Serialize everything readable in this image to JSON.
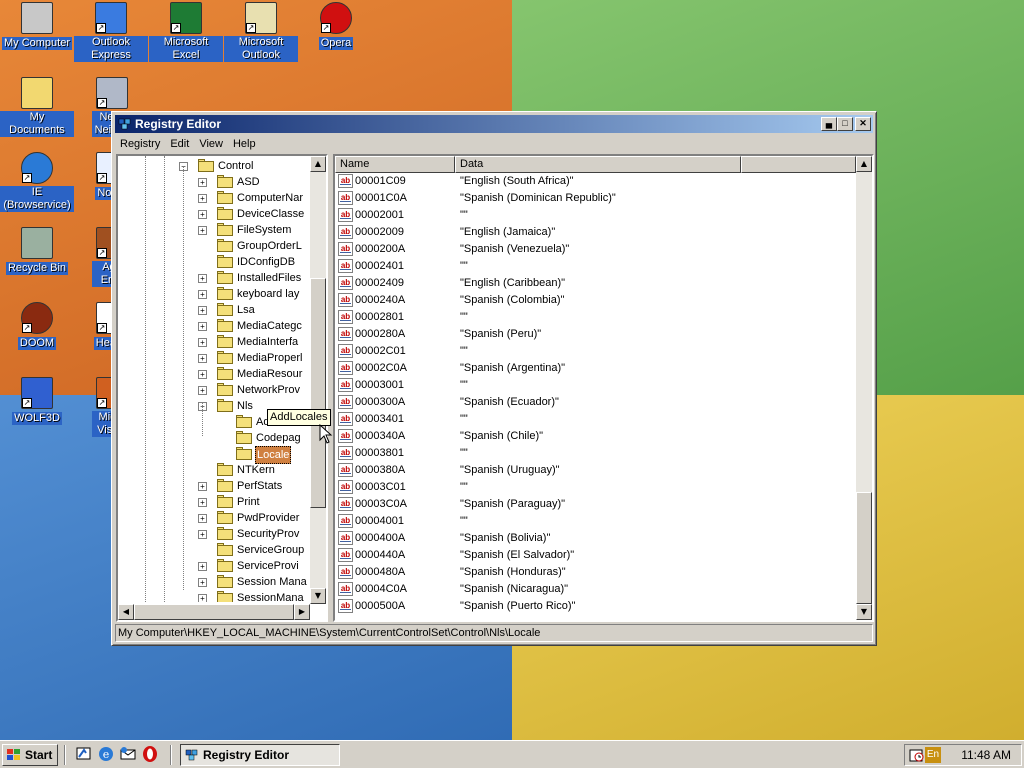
{
  "desktop": {
    "icons": [
      {
        "label": "My Computer",
        "icon": "my-computer-icon"
      },
      {
        "label": "Outlook Express",
        "icon": "outlook-express-icon"
      },
      {
        "label": "Microsoft Excel",
        "icon": "excel-icon"
      },
      {
        "label": "Microsoft Outlook",
        "icon": "outlook-icon"
      },
      {
        "label": "Opera",
        "icon": "opera-icon"
      },
      {
        "label": "My Documents",
        "icon": "my-documents-icon"
      },
      {
        "label": "Netw Neighb",
        "icon": "network-icon"
      },
      {
        "label": "IE (Browservice)",
        "icon": "ie-icon"
      },
      {
        "label": "Notep",
        "icon": "notepad-icon"
      },
      {
        "label": "Recycle Bin",
        "icon": "recycle-bin-icon"
      },
      {
        "label": "Age Emp",
        "icon": "age-of-empires-icon"
      },
      {
        "label": "DOOM",
        "icon": "doom-icon"
      },
      {
        "label": "Hearts",
        "icon": "hearts-icon"
      },
      {
        "label": "WOLF3D",
        "icon": "wolf3d-icon"
      },
      {
        "label": "Micro Visual",
        "icon": "visual-studio-icon"
      }
    ]
  },
  "window": {
    "title": "Registry Editor",
    "menu": [
      "Registry",
      "Edit",
      "View",
      "Help"
    ],
    "tree": {
      "items": [
        {
          "label": "Control",
          "expanded": true,
          "level": 0
        },
        {
          "label": "ASD",
          "level": 1
        },
        {
          "label": "ComputerNar",
          "level": 1
        },
        {
          "label": "DeviceClasse",
          "level": 1
        },
        {
          "label": "FileSystem",
          "level": 1
        },
        {
          "label": "GroupOrderL",
          "level": 1
        },
        {
          "label": "IDConfigDB",
          "level": 1
        },
        {
          "label": "InstalledFiles",
          "level": 1
        },
        {
          "label": "keyboard lay",
          "level": 1
        },
        {
          "label": "Lsa",
          "level": 1
        },
        {
          "label": "MediaCategc",
          "level": 1
        },
        {
          "label": "MediaInterfa",
          "level": 1
        },
        {
          "label": "MediaProperl",
          "level": 1
        },
        {
          "label": "MediaResour",
          "level": 1
        },
        {
          "label": "NetworkProv",
          "level": 1
        },
        {
          "label": "Nls",
          "expanded": true,
          "level": 1
        },
        {
          "label": "AddLocales",
          "level": 2
        },
        {
          "label": "Codepag",
          "level": 2
        },
        {
          "label": "Locale",
          "level": 2,
          "selected": true
        },
        {
          "label": "NTKern",
          "level": 1
        },
        {
          "label": "PerfStats",
          "level": 1
        },
        {
          "label": "Print",
          "level": 1
        },
        {
          "label": "PwdProvider",
          "level": 1
        },
        {
          "label": "SecurityProv",
          "level": 1
        },
        {
          "label": "ServiceGroup",
          "level": 1
        },
        {
          "label": "ServiceProvi",
          "level": 1
        },
        {
          "label": "Session Mana",
          "level": 1
        },
        {
          "label": "SessionMana",
          "level": 1
        }
      ]
    },
    "tooltip": "AddLocales",
    "list": {
      "columns": [
        "Name",
        "Data"
      ],
      "rows": [
        {
          "name": "00001C09",
          "data": "\"English (South Africa)\""
        },
        {
          "name": "00001C0A",
          "data": "\"Spanish (Dominican Republic)\""
        },
        {
          "name": "00002001",
          "data": "\"\""
        },
        {
          "name": "00002009",
          "data": "\"English (Jamaica)\""
        },
        {
          "name": "0000200A",
          "data": "\"Spanish (Venezuela)\""
        },
        {
          "name": "00002401",
          "data": "\"\""
        },
        {
          "name": "00002409",
          "data": "\"English (Caribbean)\""
        },
        {
          "name": "0000240A",
          "data": "\"Spanish (Colombia)\""
        },
        {
          "name": "00002801",
          "data": "\"\""
        },
        {
          "name": "0000280A",
          "data": "\"Spanish (Peru)\""
        },
        {
          "name": "00002C01",
          "data": "\"\""
        },
        {
          "name": "00002C0A",
          "data": "\"Spanish (Argentina)\""
        },
        {
          "name": "00003001",
          "data": "\"\""
        },
        {
          "name": "0000300A",
          "data": "\"Spanish (Ecuador)\""
        },
        {
          "name": "00003401",
          "data": "\"\""
        },
        {
          "name": "0000340A",
          "data": "\"Spanish (Chile)\""
        },
        {
          "name": "00003801",
          "data": "\"\""
        },
        {
          "name": "0000380A",
          "data": "\"Spanish (Uruguay)\""
        },
        {
          "name": "00003C01",
          "data": "\"\""
        },
        {
          "name": "00003C0A",
          "data": "\"Spanish (Paraguay)\""
        },
        {
          "name": "00004001",
          "data": "\"\""
        },
        {
          "name": "0000400A",
          "data": "\"Spanish (Bolivia)\""
        },
        {
          "name": "0000440A",
          "data": "\"Spanish (El Salvador)\""
        },
        {
          "name": "0000480A",
          "data": "\"Spanish (Honduras)\""
        },
        {
          "name": "00004C0A",
          "data": "\"Spanish (Nicaragua)\""
        },
        {
          "name": "0000500A",
          "data": "\"Spanish (Puerto Rico)\""
        }
      ]
    },
    "status": "My Computer\\HKEY_LOCAL_MACHINE\\System\\CurrentControlSet\\Control\\Nls\\Locale"
  },
  "taskbar": {
    "start_label": "Start",
    "task_label": "Registry Editor",
    "language": "En",
    "clock": "11:48 AM"
  },
  "colors": {
    "title_start": "#0a246a",
    "title_end": "#a6caf0",
    "selection": "#d08040",
    "face": "#d4d0c8"
  }
}
